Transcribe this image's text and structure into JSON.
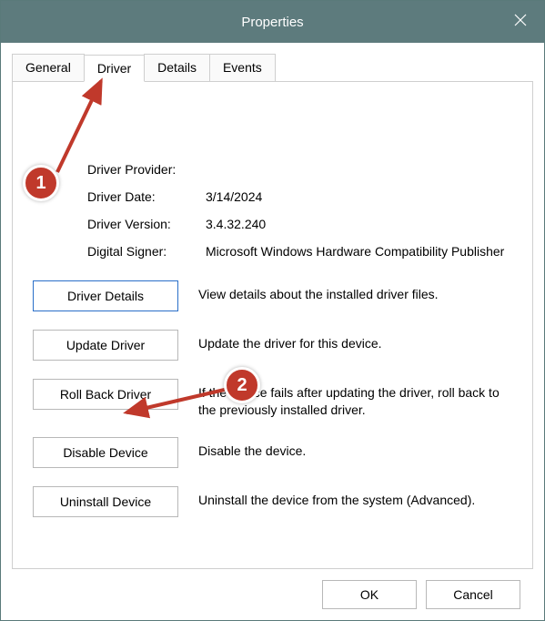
{
  "window": {
    "title": "Properties"
  },
  "tabs": [
    {
      "label": "General"
    },
    {
      "label": "Driver"
    },
    {
      "label": "Details"
    },
    {
      "label": "Events"
    }
  ],
  "info": {
    "provider_label": "Driver Provider:",
    "provider_value": "",
    "date_label": "Driver Date:",
    "date_value": "3/14/2024",
    "version_label": "Driver Version:",
    "version_value": "3.4.32.240",
    "signer_label": "Digital Signer:",
    "signer_value": "Microsoft Windows Hardware Compatibility Publisher"
  },
  "actions": {
    "details_btn": "Driver Details",
    "details_desc": "View details about the installed driver files.",
    "update_btn": "Update Driver",
    "update_desc": "Update the driver for this device.",
    "rollback_btn": "Roll Back Driver",
    "rollback_desc": "If the device fails after updating the driver, roll back to the previously installed driver.",
    "disable_btn": "Disable Device",
    "disable_desc": "Disable the device.",
    "uninstall_btn": "Uninstall Device",
    "uninstall_desc": "Uninstall the device from the system (Advanced)."
  },
  "footer": {
    "ok": "OK",
    "cancel": "Cancel"
  },
  "annotations": {
    "badge1": "1",
    "badge2": "2"
  }
}
